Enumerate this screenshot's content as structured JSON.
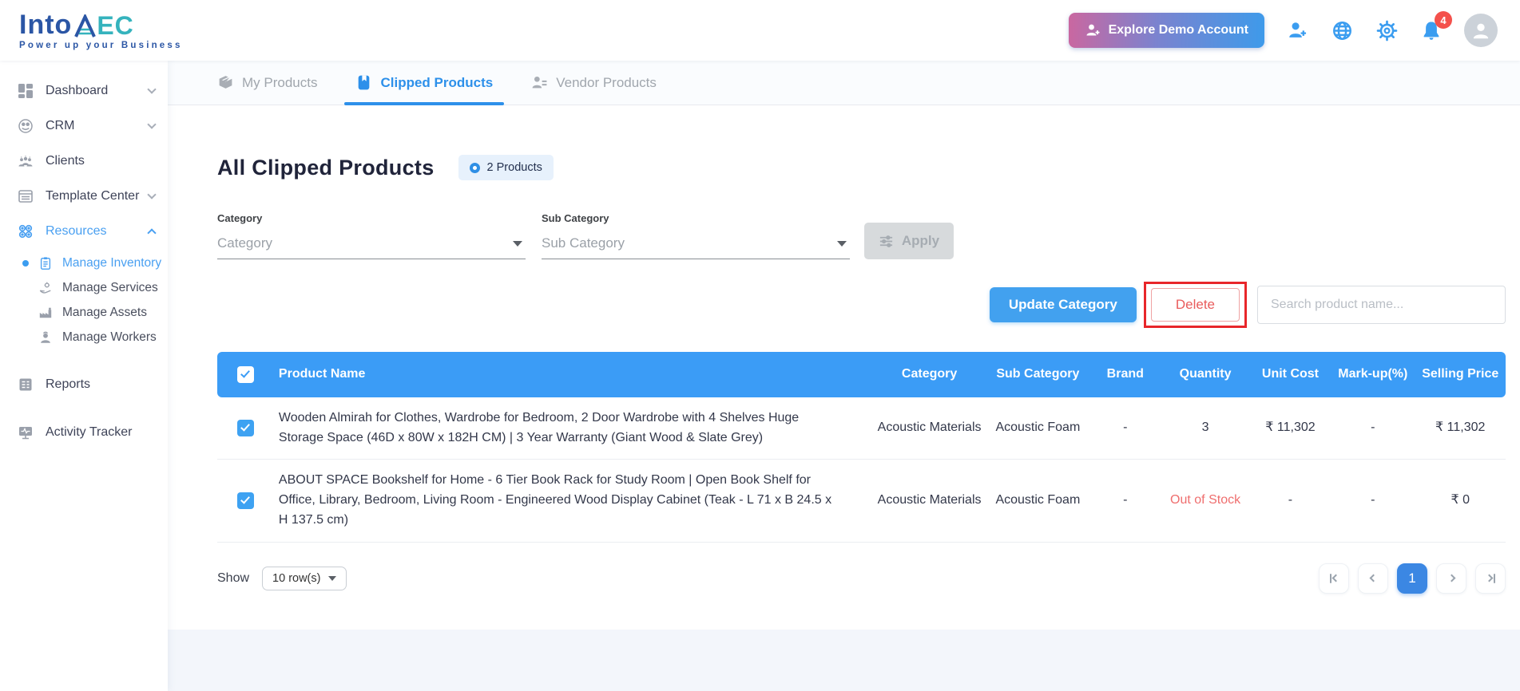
{
  "header": {
    "logo": {
      "text_primary": "Into",
      "text_secondary": "EC",
      "tagline": "Power up your Business"
    },
    "explore_button_label": "Explore Demo Account",
    "notification_count": "4",
    "icons": [
      "person-add-icon",
      "globe-icon",
      "gear-icon",
      "bell-icon",
      "avatar"
    ]
  },
  "sidebar": {
    "items": [
      {
        "label": "Dashboard",
        "chevron": "down"
      },
      {
        "label": "CRM",
        "chevron": "down"
      },
      {
        "label": "Clients"
      },
      {
        "label": "Template Center",
        "chevron": "down"
      },
      {
        "label": "Resources",
        "chevron": "up",
        "active": true
      },
      {
        "label": "Reports"
      },
      {
        "label": "Activity Tracker"
      }
    ],
    "resources_submenu": [
      {
        "label": "Manage Inventory",
        "active": true
      },
      {
        "label": "Manage Services"
      },
      {
        "label": "Manage Assets"
      },
      {
        "label": "Manage Workers"
      }
    ]
  },
  "tabs": [
    {
      "label": "My Products",
      "active": false
    },
    {
      "label": "Clipped Products",
      "active": true
    },
    {
      "label": "Vendor Products",
      "active": false
    }
  ],
  "page": {
    "title": "All Clipped Products",
    "badge_label": "2 Products"
  },
  "filters": {
    "category_label": "Category",
    "category_placeholder": "Category",
    "subcategory_label": "Sub Category",
    "subcategory_placeholder": "Sub Category",
    "apply_label": "Apply"
  },
  "actions": {
    "update_category_label": "Update Category",
    "delete_label": "Delete",
    "search_placeholder": "Search product name..."
  },
  "table": {
    "columns": [
      "Product Name",
      "Category",
      "Sub Category",
      "Brand",
      "Quantity",
      "Unit Cost",
      "Mark-up(%)",
      "Selling Price"
    ],
    "select_all_checked": true,
    "rows": [
      {
        "checked": true,
        "name": "Wooden Almirah for Clothes, Wardrobe for Bedroom, 2 Door Wardrobe with 4 Shelves Huge Storage Space (46D x 80W x 182H CM) | 3 Year Warranty (Giant Wood & Slate Grey)",
        "category": "Acoustic Materials",
        "sub_category": "Acoustic Foam",
        "brand": "-",
        "quantity": "3",
        "unit_cost": "₹ 11,302",
        "markup": "-",
        "selling_price": "₹ 11,302"
      },
      {
        "checked": true,
        "name": "ABOUT SPACE Bookshelf for Home - 6 Tier Book Rack for Study Room | Open Book Shelf for Office, Library, Bedroom, Living Room - Engineered Wood Display Cabinet (Teak - L 71 x B 24.5 x H 137.5 cm)",
        "category": "Acoustic Materials",
        "sub_category": "Acoustic Foam",
        "brand": "-",
        "quantity": "Out of Stock",
        "quantity_status": "out-of-stock",
        "unit_cost": "-",
        "markup": "-",
        "selling_price": "₹ 0"
      }
    ]
  },
  "footer": {
    "show_label": "Show",
    "rows_per_page_value": "10 row(s)",
    "pagination": {
      "current_page": "1"
    }
  },
  "colors": {
    "primary_blue": "#3b9cf6",
    "active_tab_blue": "#2d90ea",
    "annotation_red": "#e8262a",
    "delete_text_red": "#e95c5c",
    "out_of_stock_red": "#ef6e6e",
    "explore_gradient_start": "#ca67a0",
    "explore_gradient_end": "#3e9aea",
    "notification_badge_red": "#f4514c",
    "logo_blue": "#2b56a5",
    "logo_teal": "#35b3bd"
  }
}
